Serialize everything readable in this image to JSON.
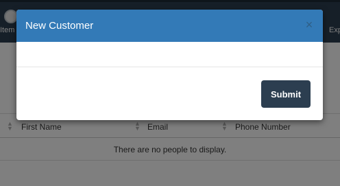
{
  "nav": {
    "left_item_label": "Item",
    "left_item_icon": "item-icon",
    "right_item_label": "Exp"
  },
  "table": {
    "columns": [
      "First Name",
      "Email",
      "Phone Number"
    ],
    "empty_message": "There are no people to display."
  },
  "modal": {
    "title": "New Customer",
    "close_symbol": "×",
    "submit_label": "Submit",
    "header_color": "#337ab7",
    "submit_color": "#2c3e50"
  }
}
